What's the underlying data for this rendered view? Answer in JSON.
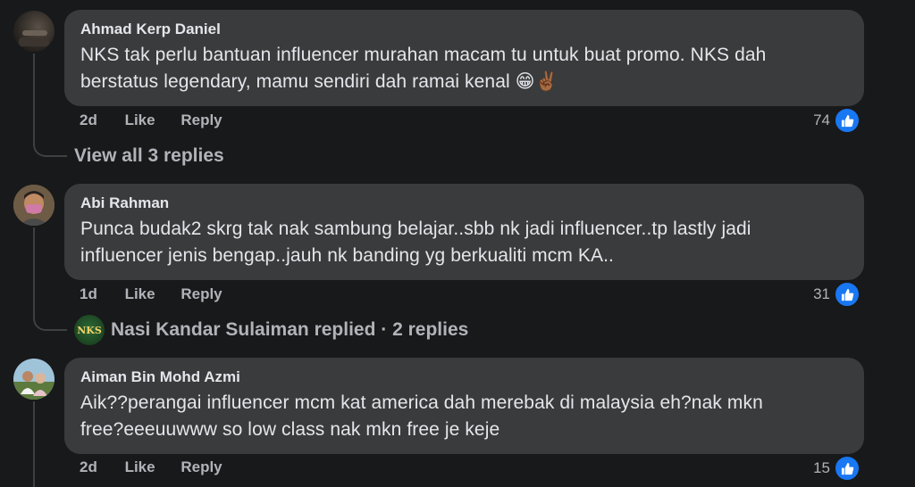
{
  "comments": [
    {
      "author": "Ahmad Kerp Daniel",
      "text_line1": "NKS tak perlu bantuan influencer murahan macam tu untuk buat promo. NKS dah",
      "text_line2": "berstatus legendary, mamu sendiri dah ramai kenal 😁✌🏾",
      "time": "2d",
      "like_label": "Like",
      "reply_label": "Reply",
      "reactions": "74",
      "replies_link": "View all 3 replies"
    },
    {
      "author": "Abi Rahman",
      "text_line1": "Punca budak2 skrg tak nak sambung belajar..sbb nk jadi influencer..tp lastly jadi",
      "text_line2": "influencer jenis bengap..jauh nk banding yg berkualiti mcm KA..",
      "time": "1d",
      "like_label": "Like",
      "reply_label": "Reply",
      "reactions": "31",
      "replies_link": "Nasi Kandar Sulaiman replied · 2 replies",
      "replier_logo_text": "NKS"
    },
    {
      "author": "Aiman Bin Mohd Azmi",
      "text_line1": "Aik??perangai influencer mcm kat america dah merebak di malaysia eh?nak mkn",
      "text_line2": "free?eeeuuwww so low class nak mkn free je keje",
      "time": "2d",
      "like_label": "Like",
      "reply_label": "Reply",
      "reactions": "15"
    }
  ],
  "colors": {
    "background": "#18191a",
    "bubble": "#3a3b3c",
    "like_blue": "#1877f2",
    "secondary_text": "#b0b3b8"
  }
}
